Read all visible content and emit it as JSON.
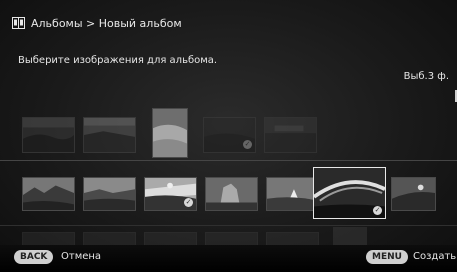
{
  "header": {
    "breadcrumb": "Альбомы > Новый альбом",
    "icon": "album-book-icon"
  },
  "instruction": "Выберите изображения для альбома.",
  "selected_count": "Выб.3 ф.",
  "tray": {
    "thumbnails": [
      {
        "id": "t1",
        "checked": false
      },
      {
        "id": "t2",
        "checked": false
      },
      {
        "id": "t3",
        "checked": false
      },
      {
        "id": "t4",
        "checked": true
      },
      {
        "id": "t5",
        "checked": false
      }
    ]
  },
  "strip": {
    "thumbnails": [
      {
        "id": "s1",
        "checked": false
      },
      {
        "id": "s2",
        "checked": false
      },
      {
        "id": "s3",
        "checked": true
      },
      {
        "id": "s4",
        "checked": false
      },
      {
        "id": "s5",
        "checked": false
      },
      {
        "id": "s6",
        "checked": true,
        "focused": true
      },
      {
        "id": "s7",
        "checked": false
      }
    ]
  },
  "footer": {
    "back_button": "BACK",
    "back_label": "Отмена",
    "menu_button": "MENU",
    "menu_label": "Создать"
  },
  "colors": {
    "background": "#1a1a1a",
    "text": "#e6e6e6",
    "button_pill": "#cfcfcf"
  }
}
